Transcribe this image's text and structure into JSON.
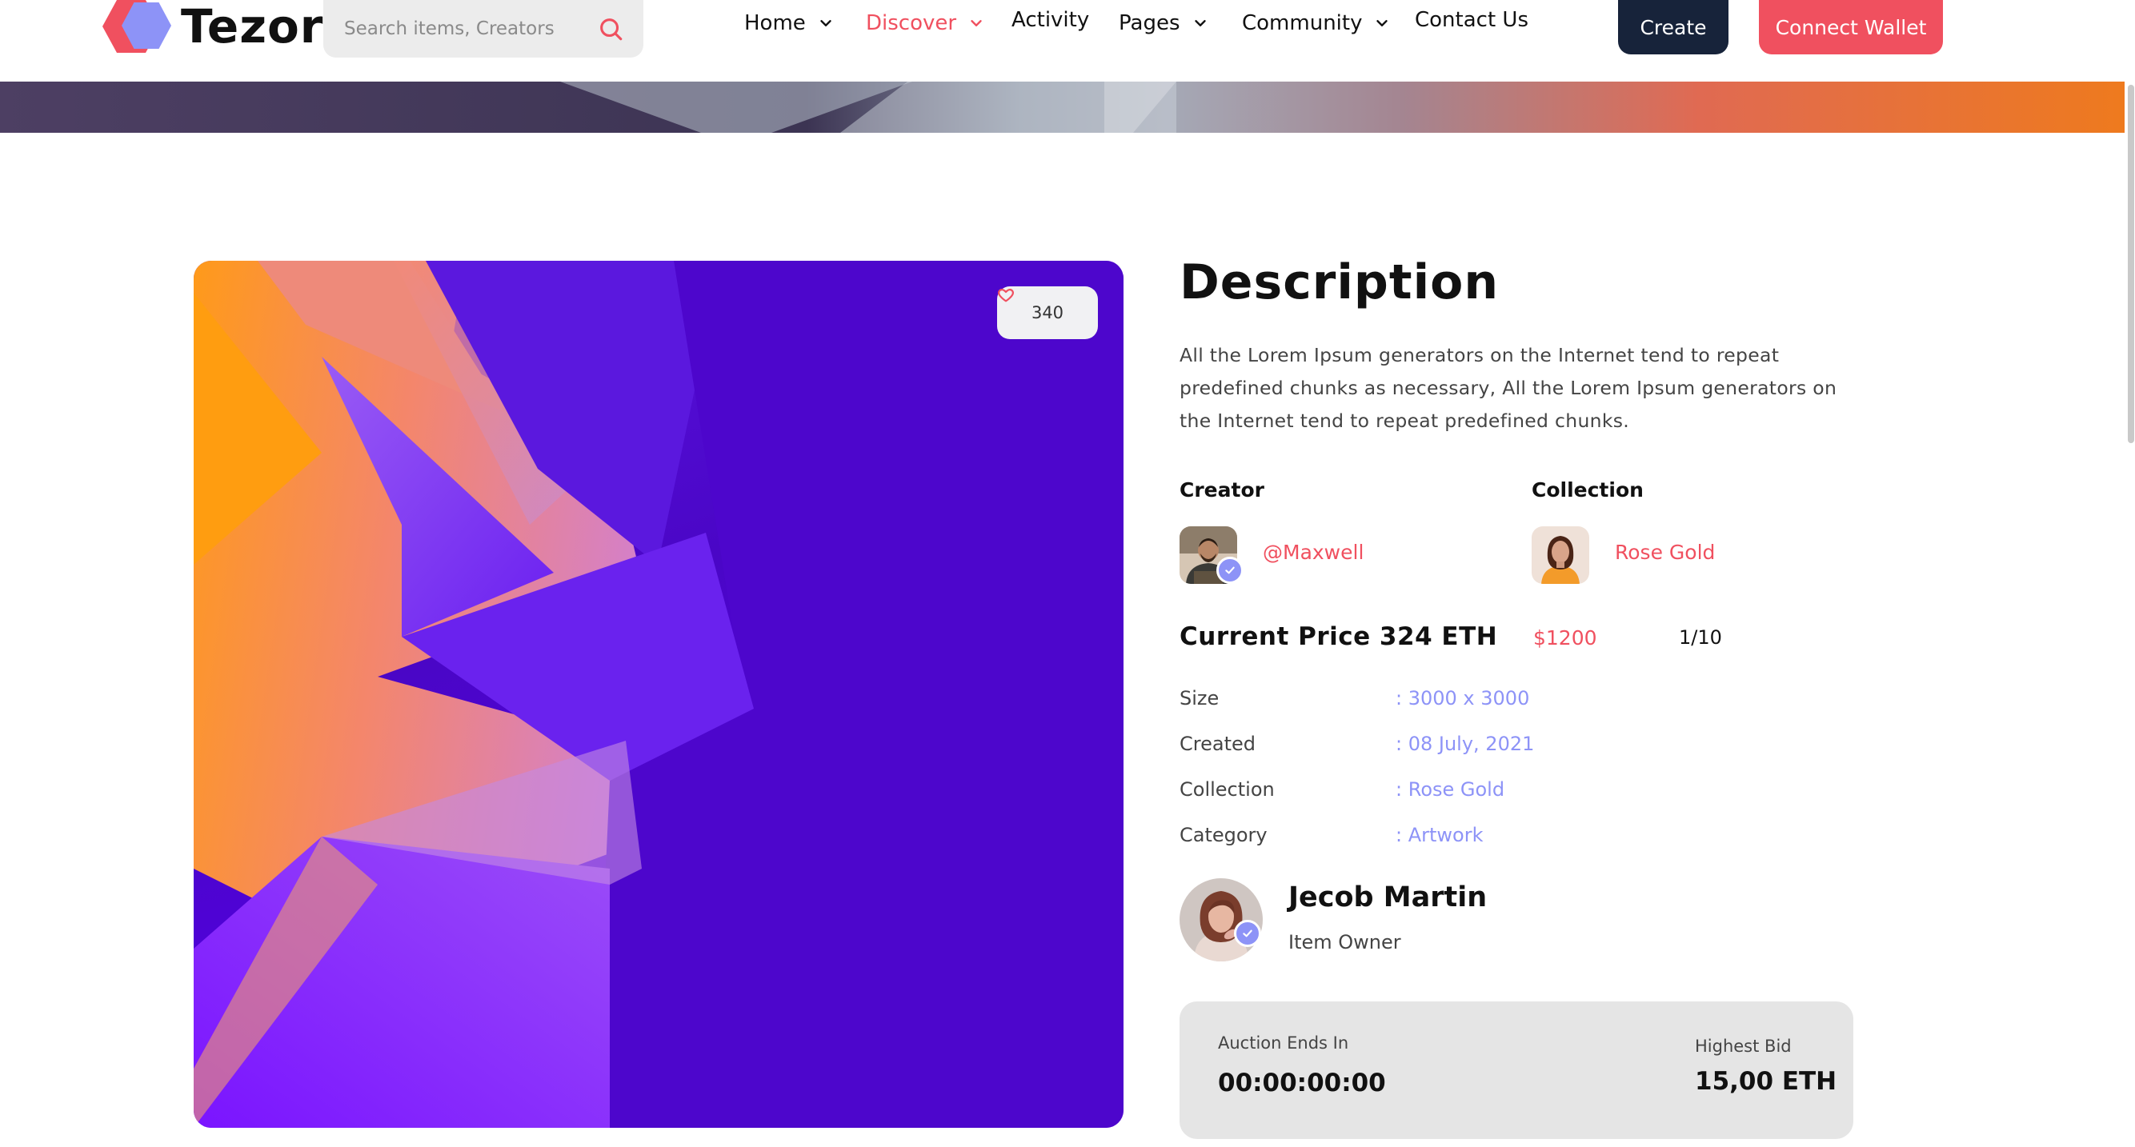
{
  "brand": {
    "name": "Tezor"
  },
  "search": {
    "placeholder": "Search items, Creators"
  },
  "nav": {
    "items": [
      {
        "label": "Home",
        "has_dropdown": true,
        "active": false
      },
      {
        "label": "Discover",
        "has_dropdown": true,
        "active": true
      },
      {
        "label": "Activity",
        "has_dropdown": false,
        "active": false
      },
      {
        "label": "Pages",
        "has_dropdown": true,
        "active": false
      },
      {
        "label": "Community",
        "has_dropdown": true,
        "active": false
      },
      {
        "label": "Contact Us",
        "has_dropdown": false,
        "active": false
      }
    ],
    "create_label": "Create",
    "wallet_label": "Connect Wallet"
  },
  "artwork": {
    "likes": "340"
  },
  "details": {
    "title": "Description",
    "description": "All the Lorem Ipsum generators on the Internet tend to repeat predefined chunks as necessary, All the Lorem Ipsum generators on the Internet tend to repeat predefined chunks.",
    "creator_label": "Creator",
    "creator_name": "@Maxwell",
    "collection_label": "Collection",
    "collection_name": "Rose Gold",
    "current_price": "Current Price 324 ETH",
    "price_usd": "$1200",
    "edition": "1/10",
    "specs": [
      {
        "label": "Size",
        "value": ": 3000 x 3000"
      },
      {
        "label": "Created",
        "value": ": 08 July, 2021"
      },
      {
        "label": "Collection",
        "value": ": Rose Gold"
      },
      {
        "label": "Category",
        "value": ": Artwork"
      }
    ],
    "owner_name": "Jecob Martin",
    "owner_role": "Item Owner"
  },
  "auction": {
    "ends_label": "Auction Ends In",
    "ends_value": "00:00:00:00",
    "bid_label": "Highest Bid",
    "bid_value": "15,00 ETH"
  },
  "colors": {
    "accent": "#f0505f",
    "secondary": "#8d93f7",
    "dark": "#17233a"
  },
  "icons": [
    "search-icon",
    "chevron-down-icon",
    "heart-icon",
    "verified-icon"
  ]
}
